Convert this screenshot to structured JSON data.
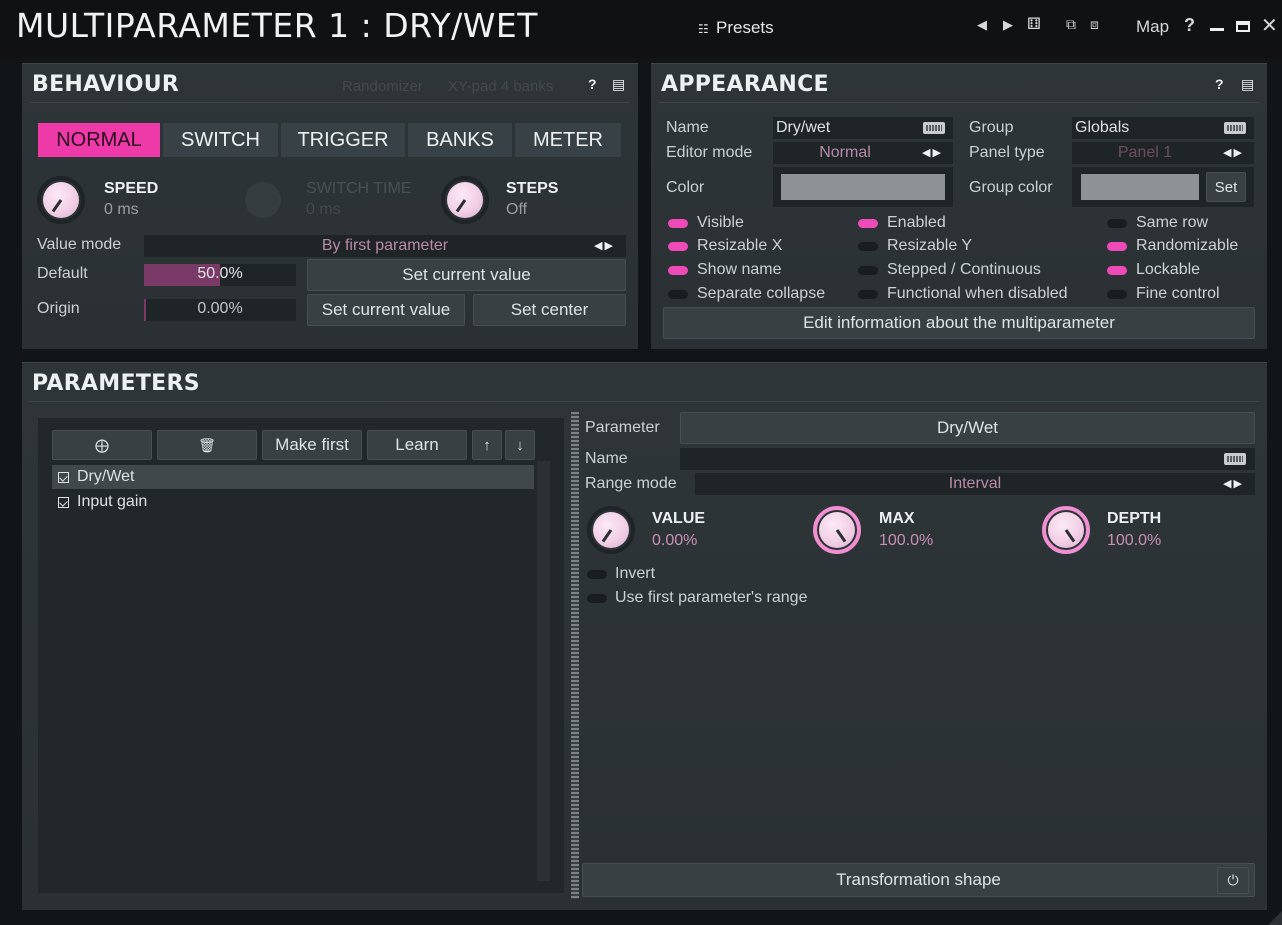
{
  "title": "MULTIPARAMETER 1 : DRY/WET",
  "titlebar": {
    "presets_label": "Presets",
    "map_label": "Map",
    "help_label": "?",
    "icons": [
      "prev-icon",
      "next-icon",
      "random-dice-icon",
      "copy-icon",
      "paste-icon",
      "help-icon",
      "minimize-icon",
      "maximize-icon",
      "close-icon"
    ]
  },
  "behaviour": {
    "title": "BEHAVIOUR",
    "randomizer_label": "Randomizer",
    "xypad_label": "XY-pad 4 banks",
    "modes": [
      "NORMAL",
      "SWITCH",
      "TRIGGER",
      "BANKS",
      "METER"
    ],
    "active_mode": "NORMAL",
    "speed": {
      "label": "SPEED",
      "value": "0 ms"
    },
    "switch_time": {
      "label": "SWITCH TIME",
      "value": "0 ms"
    },
    "steps": {
      "label": "STEPS",
      "value": "Off"
    },
    "value_mode_label": "Value mode",
    "value_mode_value": "By first parameter",
    "default_label": "Default",
    "default_value": "50.0%",
    "default_fraction": 0.5,
    "set_current_value_label": "Set current value",
    "origin_label": "Origin",
    "origin_value": "0.00%",
    "origin_set_current_label": "Set current value",
    "set_center_label": "Set center"
  },
  "appearance": {
    "title": "APPEARANCE",
    "name_label": "Name",
    "name_value": "Dry/wet",
    "group_label": "Group",
    "group_value": "Globals",
    "editor_mode_label": "Editor mode",
    "editor_mode_value": "Normal",
    "panel_type_label": "Panel type",
    "panel_type_value": "Panel 1",
    "color_label": "Color",
    "group_color_label": "Group color",
    "set_label": "Set",
    "swatch_color": "#8e9294",
    "toggles": [
      {
        "label": "Visible",
        "on": true
      },
      {
        "label": "Enabled",
        "on": true
      },
      {
        "label": "Same row",
        "on": false
      },
      {
        "label": "Resizable X",
        "on": true
      },
      {
        "label": "Resizable Y",
        "on": false
      },
      {
        "label": "Randomizable",
        "on": true
      },
      {
        "label": "Show name",
        "on": true
      },
      {
        "label": "Stepped / Continuous",
        "on": false
      },
      {
        "label": "Lockable",
        "on": true
      },
      {
        "label": "Separate collapse",
        "on": false
      },
      {
        "label": "Functional when disabled",
        "on": false
      },
      {
        "label": "Fine control",
        "on": false
      }
    ],
    "edit_info_label": "Edit information about the multiparameter"
  },
  "parameters": {
    "title": "PARAMETERS",
    "toolbar": {
      "make_first_label": "Make first",
      "learn_label": "Learn"
    },
    "items": [
      {
        "label": "Dry/Wet",
        "selected": true
      },
      {
        "label": "Input gain",
        "selected": false
      }
    ],
    "parameter_label": "Parameter",
    "parameter_value": "Dry/Wet",
    "name_label": "Name",
    "range_mode_label": "Range mode",
    "range_mode_value": "Interval",
    "value": {
      "label": "VALUE",
      "value": "0.00%"
    },
    "max": {
      "label": "MAX",
      "value": "100.0%"
    },
    "depth": {
      "label": "DEPTH",
      "value": "100.0%"
    },
    "invert_label": "Invert",
    "use_first_range_label": "Use first parameter's range",
    "transformation_shape_label": "Transformation shape"
  },
  "colors": {
    "accent": "#ee3aa8",
    "panel_bg": "#2e3538",
    "window_bg": "#121517"
  }
}
